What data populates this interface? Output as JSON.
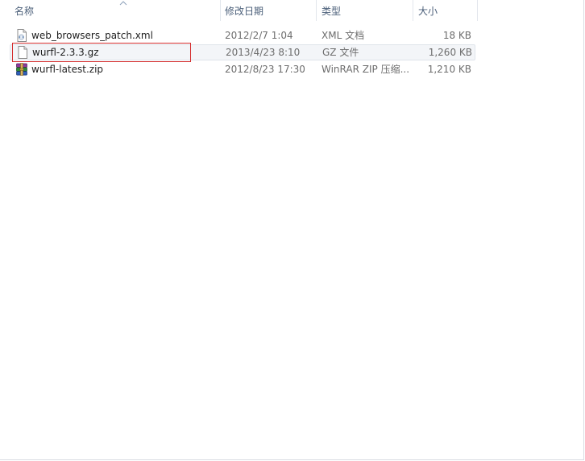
{
  "columns": {
    "name": "名称",
    "date_modified": "修改日期",
    "type": "类型",
    "size": "大小"
  },
  "sort": {
    "column": "name",
    "direction": "ascending"
  },
  "files": [
    {
      "name": "web_browsers_patch.xml",
      "date_modified": "2012/2/7 1:04",
      "type": "XML 文档",
      "size": "18 KB",
      "icon": "xml-document-icon"
    },
    {
      "name": "wurfl-2.3.3.gz",
      "date_modified": "2013/4/23 8:10",
      "type": "GZ 文件",
      "size": "1,260 KB",
      "icon": "generic-file-icon",
      "highlighted": true
    },
    {
      "name": "wurfl-latest.zip",
      "date_modified": "2012/8/23 17:30",
      "type": "WinRAR ZIP 压缩...",
      "size": "1,210 KB",
      "icon": "winrar-archive-icon"
    }
  ],
  "colors": {
    "header_text": "#4c607a",
    "row_hover_bg": "#f3f5f8",
    "annotation_box": "#d42c2c",
    "secondary_text": "#6d6d6d"
  }
}
